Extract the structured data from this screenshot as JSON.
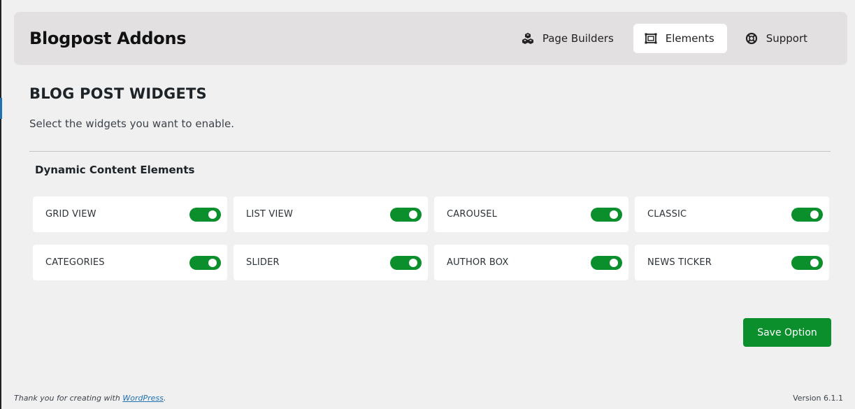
{
  "header": {
    "title": "Blogpost Addons",
    "nav": [
      {
        "label": "Page Builders",
        "icon": "cubes-icon"
      },
      {
        "label": "Elements",
        "icon": "frame-icon",
        "active": true
      },
      {
        "label": "Support",
        "icon": "lifebuoy-icon"
      }
    ]
  },
  "main": {
    "title": "BLOG POST WIDGETS",
    "subtitle": "Select the widgets you want to enable.",
    "section_title": "Dynamic Content Elements",
    "widgets": [
      {
        "label": "GRID VIEW",
        "enabled": true
      },
      {
        "label": "LIST VIEW",
        "enabled": true
      },
      {
        "label": "CAROUSEL",
        "enabled": true
      },
      {
        "label": "CLASSIC",
        "enabled": true
      },
      {
        "label": "CATEGORIES",
        "enabled": true
      },
      {
        "label": "SLIDER",
        "enabled": true
      },
      {
        "label": "AUTHOR BOX",
        "enabled": true
      },
      {
        "label": "NEWS TICKER",
        "enabled": true
      }
    ],
    "save_label": "Save Option"
  },
  "footer": {
    "thanks_prefix": "Thank you for creating with",
    "link_text": "WordPress",
    "thanks_suffix": ".",
    "version": "Version 6.1.1"
  },
  "colors": {
    "accent_green": "#0a8f2c",
    "header_bg": "#e2e0e0",
    "page_bg": "#f0f0f1",
    "link": "#2271b1"
  }
}
